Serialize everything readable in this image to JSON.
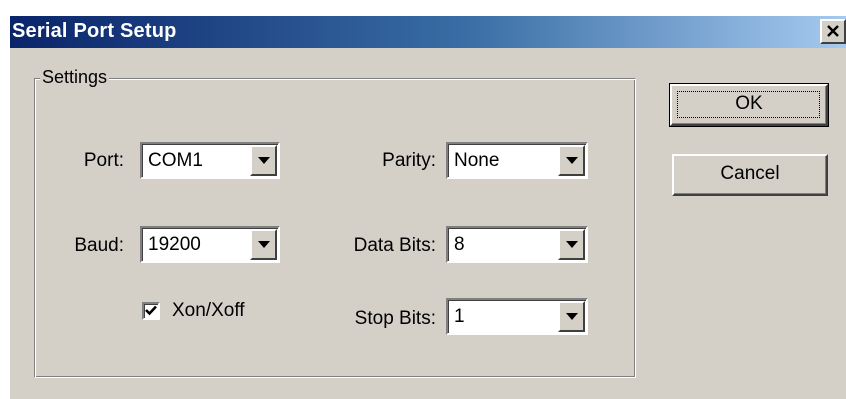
{
  "window": {
    "title": "Serial Port Setup"
  },
  "settings": {
    "group_label": "Settings",
    "port": {
      "label": "Port:",
      "value": "COM1"
    },
    "baud": {
      "label": "Baud:",
      "value": "19200"
    },
    "parity": {
      "label": "Parity:",
      "value": "None"
    },
    "data_bits": {
      "label": "Data Bits:",
      "value": "8"
    },
    "stop_bits": {
      "label": "Stop Bits:",
      "value": "1"
    },
    "xon_xoff": {
      "label": "Xon/Xoff",
      "checked": true
    }
  },
  "buttons": {
    "ok_label": "OK",
    "cancel_label": "Cancel"
  },
  "icons": {
    "close": "close-icon",
    "dropdown": "chevron-down-icon",
    "check": "checkmark-icon"
  }
}
